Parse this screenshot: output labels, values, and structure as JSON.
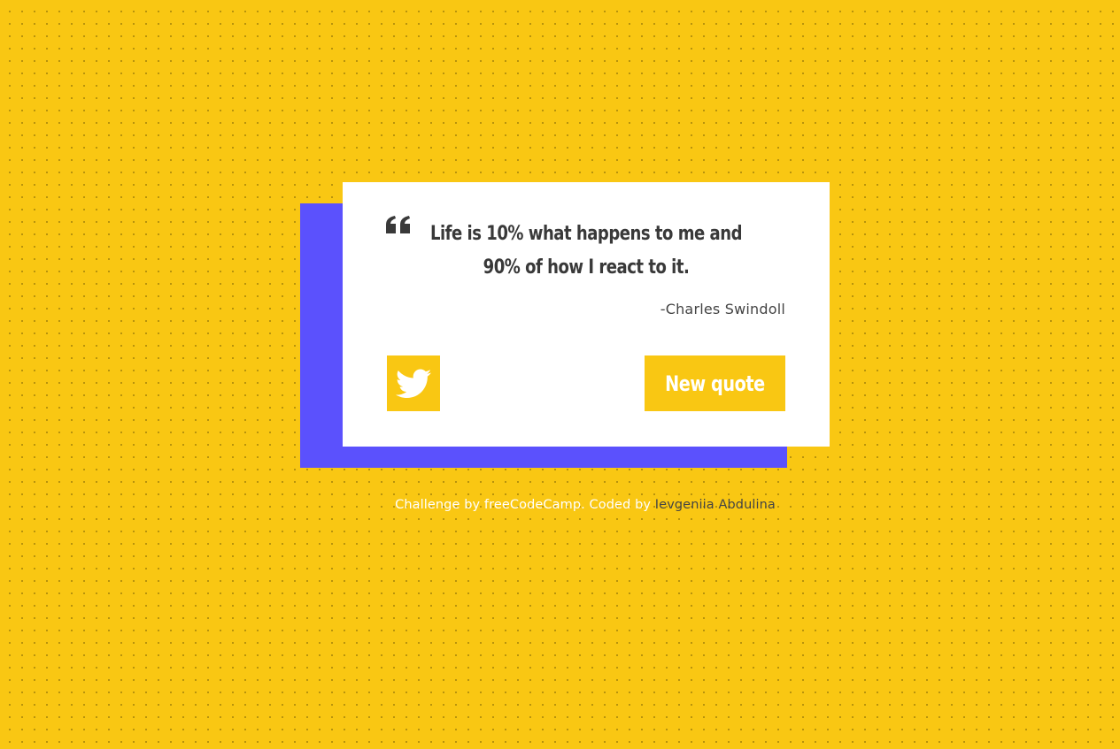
{
  "quote": {
    "text": "Life is 10% what happens to me and 90% of how I react to it.",
    "author": "-Charles Swindoll"
  },
  "actions": {
    "tweet_icon": "twitter-icon",
    "new_quote_label": "New quote"
  },
  "footer": {
    "prefix": "Challenge by ",
    "fcc_link": "freeCodeCamp",
    "middle": ". Coded by ",
    "author_link": "Ievgeniia Abdulina"
  },
  "colors": {
    "background": "#f9c713",
    "accent_block": "#5b51fd",
    "card": "#ffffff",
    "text_dark": "#393939"
  }
}
